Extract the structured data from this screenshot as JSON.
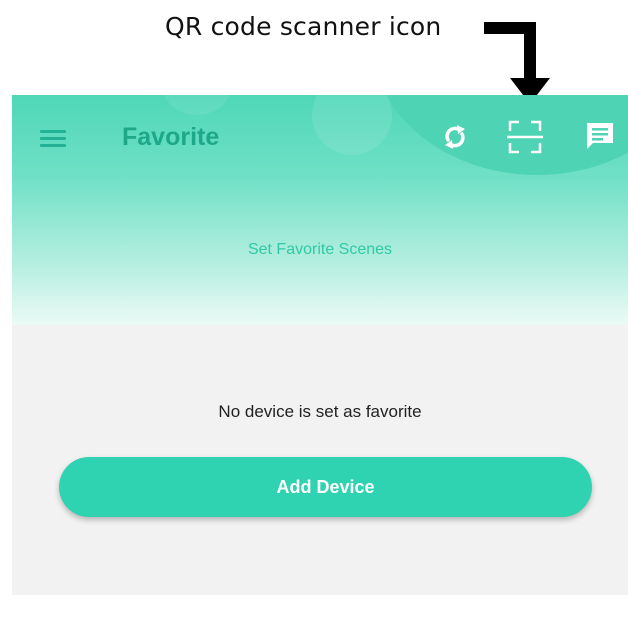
{
  "annotation": {
    "label": "QR code scanner icon"
  },
  "header": {
    "title": "Favorite",
    "subtitle": "Set Favorite Scenes",
    "icons": [
      "menu-icon",
      "sync-icon",
      "qr-scanner-icon",
      "message-icon"
    ]
  },
  "main": {
    "empty_text": "No device is set as favorite",
    "add_button_label": "Add Device"
  },
  "colors": {
    "accent": "#2fd3b1",
    "title": "#1ea88a",
    "header_top": "#4fd7b8",
    "background": "#f2f2f2"
  }
}
